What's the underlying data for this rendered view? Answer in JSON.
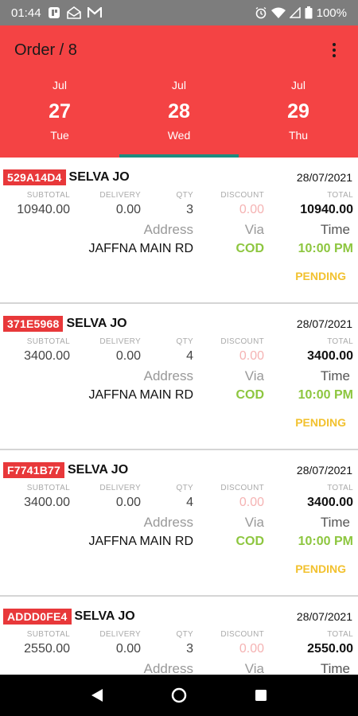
{
  "status_bar": {
    "time": "01:44",
    "battery": "100%",
    "left_icons": [
      "tv-app-icon",
      "mail-open-icon",
      "gmail-icon"
    ],
    "right_icons": [
      "alarm-icon",
      "wifi-icon",
      "signal-icon",
      "battery-icon"
    ]
  },
  "header": {
    "title": "Order / 8",
    "menu_icon": "more-vert-icon",
    "background": "#f44344",
    "indicator_color": "#1d8c7e"
  },
  "dates": [
    {
      "month": "Jul",
      "day": "27",
      "dow": "Tue",
      "active": false
    },
    {
      "month": "Jul",
      "day": "28",
      "dow": "Wed",
      "active": true
    },
    {
      "month": "Jul",
      "day": "29",
      "dow": "Thu",
      "active": false
    }
  ],
  "labels": {
    "subtotal": "SUBTOTAL",
    "delivery": "DELIVERY",
    "qty": "QTY",
    "discount": "DISCOUNT",
    "total": "TOTAL",
    "address": "Address",
    "via": "Via",
    "time": "Time"
  },
  "orders": [
    {
      "id": "529A14D4",
      "customer": "SELVA JO",
      "date": "28/07/2021",
      "subtotal": "10940.00",
      "delivery": "0.00",
      "qty": "3",
      "discount": "0.00",
      "total": "10940.00",
      "address": "JAFFNA MAIN RD",
      "via": "COD",
      "time": "10:00 PM",
      "status": "PENDING"
    },
    {
      "id": "371E5968",
      "customer": "SELVA JO",
      "date": "28/07/2021",
      "subtotal": "3400.00",
      "delivery": "0.00",
      "qty": "4",
      "discount": "0.00",
      "total": "3400.00",
      "address": "JAFFNA MAIN RD",
      "via": "COD",
      "time": "10:00 PM",
      "status": "PENDING"
    },
    {
      "id": "F7741B77",
      "customer": "SELVA JO",
      "date": "28/07/2021",
      "subtotal": "3400.00",
      "delivery": "0.00",
      "qty": "4",
      "discount": "0.00",
      "total": "3400.00",
      "address": "JAFFNA MAIN RD",
      "via": "COD",
      "time": "10:00 PM",
      "status": "PENDING"
    },
    {
      "id": "ADDD0FE4",
      "customer": "SELVA JO",
      "date": "28/07/2021",
      "subtotal": "2550.00",
      "delivery": "0.00",
      "qty": "3",
      "discount": "0.00",
      "total": "2550.00",
      "address": "",
      "via": "",
      "time": "",
      "status": ""
    }
  ],
  "colors": {
    "id_badge": "#e8383a",
    "cod": "#8dc63f",
    "pending": "#f2c12e",
    "discount": "#f5b3b3"
  },
  "nav_bar": {
    "buttons": [
      "back-icon",
      "home-icon",
      "recents-icon"
    ]
  }
}
